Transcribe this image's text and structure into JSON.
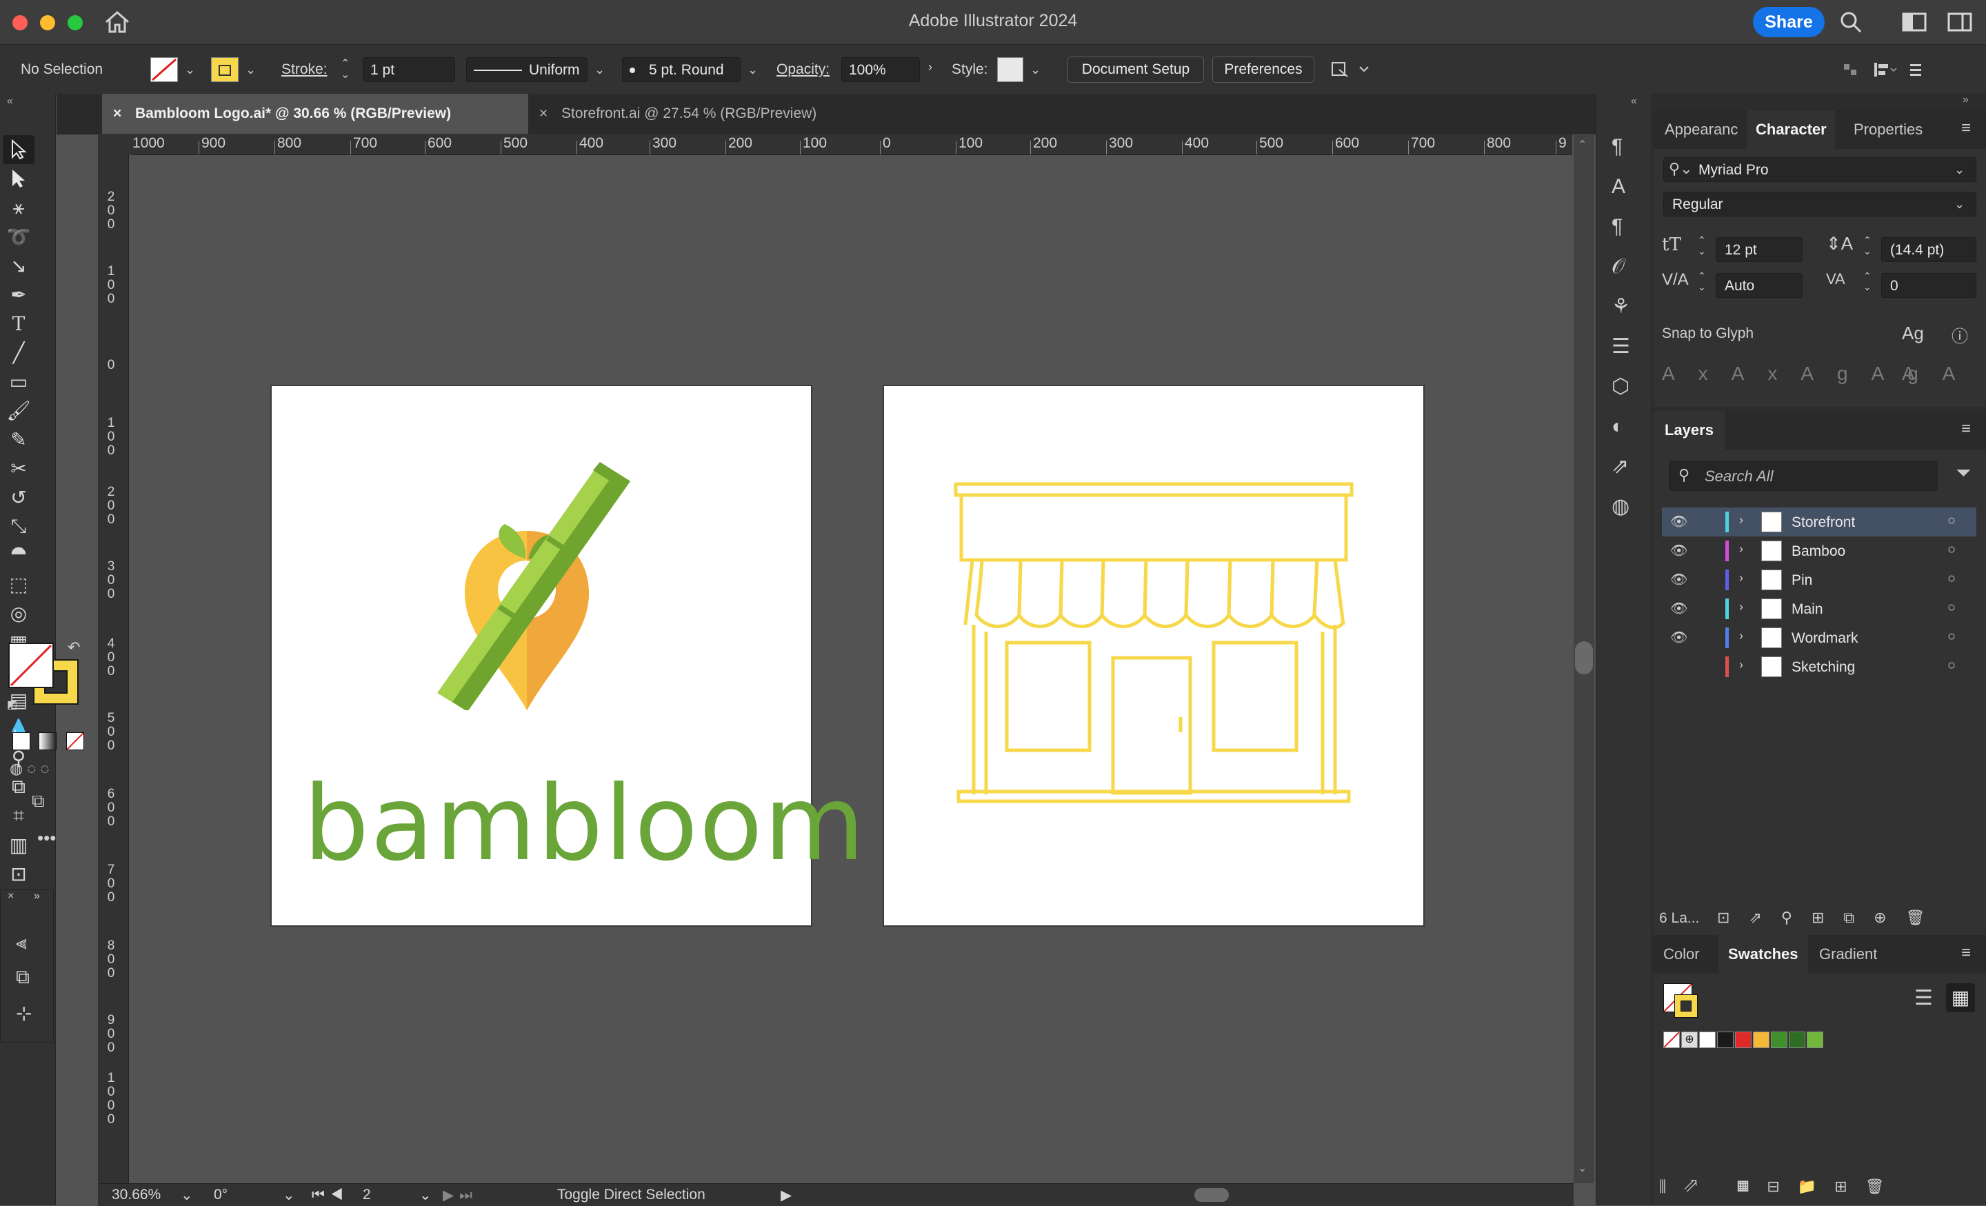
{
  "app": {
    "title": "Adobe Illustrator 2024",
    "share_label": "Share"
  },
  "control_bar": {
    "selection": "No Selection",
    "stroke_label": "Stroke:",
    "stroke_weight": "1 pt",
    "stroke_profile": "Uniform",
    "brush": "5 pt. Round",
    "opacity_label": "Opacity:",
    "opacity_value": "100%",
    "style_label": "Style:",
    "document_setup": "Document Setup",
    "preferences": "Preferences"
  },
  "tabs": [
    {
      "label": "Bambloom Logo.ai* @ 30.66 % (RGB/Preview)",
      "active": true
    },
    {
      "label": "Storefront.ai @ 27.54 % (RGB/Preview)",
      "active": false
    }
  ],
  "ruler_h": [
    "1000",
    "900",
    "800",
    "700",
    "600",
    "500",
    "400",
    "300",
    "200",
    "100",
    "0",
    "100",
    "200",
    "300",
    "400",
    "500",
    "600",
    "700",
    "800",
    "9"
  ],
  "ruler_v": [
    "200",
    "100",
    "0",
    "100",
    "200",
    "300",
    "400",
    "500",
    "600",
    "700",
    "800",
    "900",
    "1000"
  ],
  "artboards": {
    "logo_wordmark": "bambloom",
    "colors": {
      "bamboo_light": "#a6d14a",
      "bamboo_dark": "#6fa52e",
      "pin_light": "#f9c342",
      "pin_dark": "#f0a73b",
      "wordmark": "#6aa539",
      "storefront_stroke": "#f7d84a"
    }
  },
  "status_bar": {
    "zoom": "30.66%",
    "rotation": "0°",
    "artboard_index": "2",
    "status": "Toggle Direct Selection"
  },
  "character_panel": {
    "tabs": [
      "Appearanc",
      "Character",
      "Properties"
    ],
    "font_family": "Myriad Pro",
    "font_style": "Regular",
    "font_size": "12 pt",
    "leading": "(14.4 pt)",
    "kerning": "Auto",
    "tracking": "0",
    "snap_to_glyph": "Snap to Glyph"
  },
  "layers_panel": {
    "title": "Layers",
    "search_placeholder": "Search All",
    "count_label": "6 La...",
    "layers": [
      {
        "name": "Storefront",
        "color": "#4fd1e0",
        "visible": true,
        "selected": true
      },
      {
        "name": "Bamboo",
        "color": "#d14fd6",
        "visible": true,
        "selected": false
      },
      {
        "name": "Pin",
        "color": "#5b5fe8",
        "visible": true,
        "selected": false
      },
      {
        "name": "Main",
        "color": "#4fd1e0",
        "visible": true,
        "selected": false
      },
      {
        "name": "Wordmark",
        "color": "#4f7fe8",
        "visible": true,
        "selected": false
      },
      {
        "name": "Sketching",
        "color": "#e04f4f",
        "visible": false,
        "selected": false
      }
    ]
  },
  "swatches_panel": {
    "tabs": [
      "Color",
      "Swatches",
      "Gradient"
    ],
    "swatches": [
      "none",
      "registration",
      "#ffffff",
      "#1a1a1a",
      "#e02a2a",
      "#f5b93a",
      "#3f8f2b",
      "#2f6e22",
      "#6fb83a"
    ]
  }
}
